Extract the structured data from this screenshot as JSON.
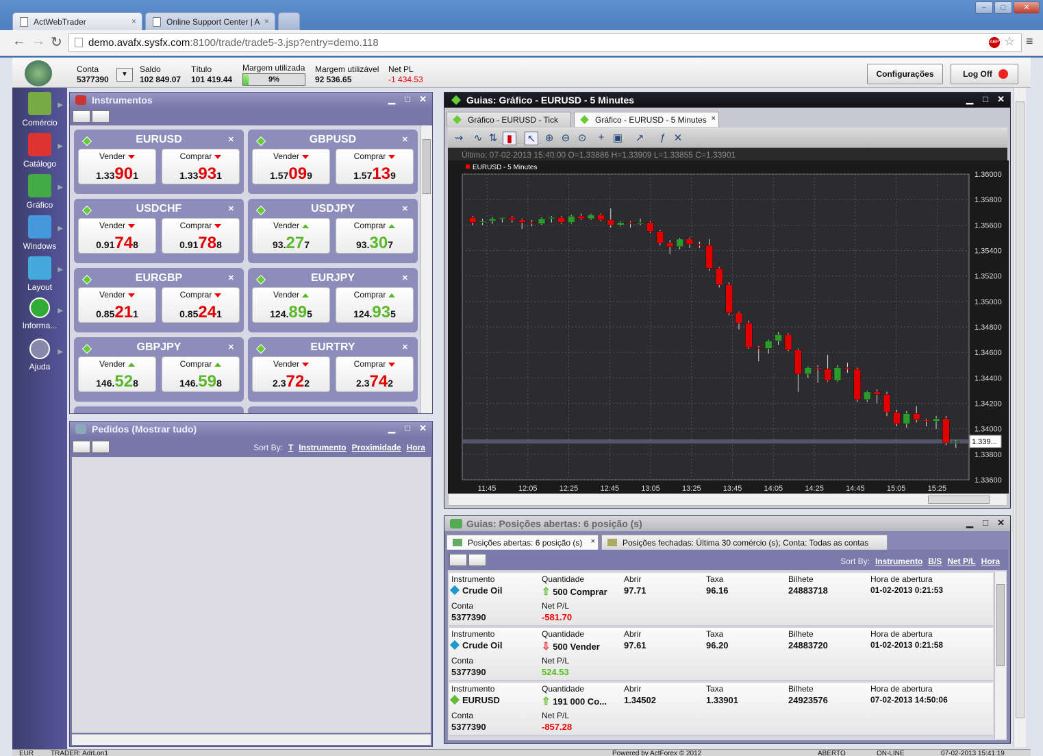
{
  "browser": {
    "tabs": [
      "ActWebTrader",
      "Online Support Center | A"
    ],
    "url_host": "demo.avafx.sysfx.com",
    "url_rest": ":8100/trade/trade5-3.jsp?entry=demo.118"
  },
  "header": {
    "conta_label": "Conta",
    "conta_value": "5377390",
    "saldo_label": "Saldo",
    "saldo_value": "102 849.07",
    "titulo_label": "Título",
    "titulo_value": "101 419.44",
    "margem_util_label": "Margem utilizada",
    "margem_util_value": "9%",
    "margem_util_fraction": 0.09,
    "margem_disp_label": "Margem utilizável",
    "margem_disp_value": "92 536.65",
    "netpl_label": "Net PL",
    "netpl_value": "-1 434.53",
    "config_button": "Configurações",
    "logoff_button": "Log Off"
  },
  "sidebar": [
    {
      "label": "Comércio",
      "icon": "money-icon"
    },
    {
      "label": "Catálogo",
      "icon": "currency-icon"
    },
    {
      "label": "Gráfico",
      "icon": "chart-icon"
    },
    {
      "label": "Windows",
      "icon": "windows-icon"
    },
    {
      "label": "Layout",
      "icon": "layout-icon"
    },
    {
      "label": "Informa...",
      "icon": "info-icon"
    },
    {
      "label": "Ajuda",
      "icon": "help-icon"
    }
  ],
  "instruments_panel": {
    "title": "Instrumentos",
    "sell_label": "Vender",
    "buy_label": "Comprar",
    "cards": [
      {
        "name": "EURUSD",
        "dir_sell": "down",
        "dir_buy": "down",
        "sell": [
          "1.33",
          "90",
          "1"
        ],
        "buy": [
          "1.33",
          "93",
          "1"
        ]
      },
      {
        "name": "GBPUSD",
        "dir_sell": "down",
        "dir_buy": "down",
        "sell": [
          "1.57",
          "09",
          "9"
        ],
        "buy": [
          "1.57",
          "13",
          "9"
        ]
      },
      {
        "name": "USDCHF",
        "dir_sell": "down",
        "dir_buy": "down",
        "sell": [
          "0.91",
          "74",
          "8"
        ],
        "buy": [
          "0.91",
          "78",
          "8"
        ]
      },
      {
        "name": "USDJPY",
        "dir_sell": "up",
        "dir_buy": "up",
        "sell": [
          "93.",
          "27",
          "7"
        ],
        "buy": [
          "93.",
          "30",
          "7"
        ]
      },
      {
        "name": "EURGBP",
        "dir_sell": "down",
        "dir_buy": "down",
        "sell": [
          "0.85",
          "21",
          "1"
        ],
        "buy": [
          "0.85",
          "24",
          "1"
        ]
      },
      {
        "name": "EURJPY",
        "dir_sell": "up",
        "dir_buy": "up",
        "sell": [
          "124.",
          "89",
          "5"
        ],
        "buy": [
          "124.",
          "93",
          "5"
        ]
      },
      {
        "name": "GBPJPY",
        "dir_sell": "up",
        "dir_buy": "up",
        "sell": [
          "146.",
          "52",
          "8"
        ],
        "buy": [
          "146.",
          "59",
          "8"
        ]
      },
      {
        "name": "EURTRY",
        "dir_sell": "down",
        "dir_buy": "down",
        "sell": [
          "2.3",
          "72",
          "2"
        ],
        "buy": [
          "2.3",
          "74",
          "2"
        ]
      }
    ]
  },
  "orders_panel": {
    "title": "Pedidos (Mostrar tudo)",
    "sort_label": "Sort By:",
    "sort_links": [
      "T",
      "Instrumento",
      "Proximidade",
      "Hora"
    ]
  },
  "chart_panel": {
    "title": "Guias: Gráfico - EURUSD - 5 Minutes",
    "tabs": [
      "Gráfico - EURUSD - Tick",
      "Gráfico - EURUSD - 5 Minutes"
    ],
    "info_line": "Último: 07-02-2013 15:40:00 O=1.33886 H=1.33909 L=1.33855 C=1.33901",
    "current_price_label": "1.339..."
  },
  "chart_data": {
    "type": "candlestick",
    "series_name": "EURUSD - 5 Minutes",
    "x_ticks": [
      "11:45",
      "12:05",
      "12:25",
      "12:45",
      "13:05",
      "13:25",
      "13:45",
      "14:05",
      "14:25",
      "14:45",
      "15:05",
      "15:25"
    ],
    "y_ticks": [
      "1.36000",
      "1.35800",
      "1.35600",
      "1.35400",
      "1.35200",
      "1.35000",
      "1.34800",
      "1.34600",
      "1.34400",
      "1.34200",
      "1.34000",
      "1.33800",
      "1.33600"
    ],
    "ylim": [
      1.336,
      1.36
    ],
    "current_price": 1.33901,
    "grid": true,
    "up_color": "#2a9a2a",
    "down_color": "#e00000",
    "candles": [
      [
        1.3566,
        1.3567,
        1.356,
        1.3562
      ],
      [
        1.3562,
        1.3565,
        1.356,
        1.3563
      ],
      [
        1.3563,
        1.3566,
        1.3561,
        1.3565
      ],
      [
        1.3565,
        1.3566,
        1.3562,
        1.3566
      ],
      [
        1.3566,
        1.3567,
        1.3562,
        1.3564
      ],
      [
        1.3564,
        1.3565,
        1.3557,
        1.3562
      ],
      [
        1.3562,
        1.3564,
        1.3559,
        1.3561
      ],
      [
        1.3561,
        1.3566,
        1.356,
        1.3565
      ],
      [
        1.3565,
        1.3567,
        1.3562,
        1.3566
      ],
      [
        1.3566,
        1.3567,
        1.3561,
        1.3562
      ],
      [
        1.3562,
        1.3568,
        1.3561,
        1.3567
      ],
      [
        1.3567,
        1.3569,
        1.3564,
        1.3565
      ],
      [
        1.3565,
        1.3569,
        1.3564,
        1.3568
      ],
      [
        1.3568,
        1.3569,
        1.3563,
        1.3564
      ],
      [
        1.3564,
        1.3573,
        1.3558,
        1.356
      ],
      [
        1.356,
        1.3563,
        1.3559,
        1.3562
      ],
      [
        1.3562,
        1.3563,
        1.3558,
        1.3561
      ],
      [
        1.3561,
        1.3565,
        1.356,
        1.3562
      ],
      [
        1.3562,
        1.3563,
        1.3554,
        1.3555
      ],
      [
        1.3555,
        1.3556,
        1.3544,
        1.3546
      ],
      [
        1.3546,
        1.3548,
        1.3537,
        1.3543
      ],
      [
        1.3543,
        1.355,
        1.3541,
        1.3549
      ],
      [
        1.3549,
        1.355,
        1.3542,
        1.3545
      ],
      [
        1.3545,
        1.3547,
        1.3542,
        1.3544
      ],
      [
        1.3544,
        1.3549,
        1.3524,
        1.3526
      ],
      [
        1.3526,
        1.3527,
        1.3511,
        1.3513
      ],
      [
        1.3513,
        1.3515,
        1.3489,
        1.3491
      ],
      [
        1.3491,
        1.3492,
        1.3478,
        1.3483
      ],
      [
        1.3483,
        1.3485,
        1.3463,
        1.3464
      ],
      [
        1.3464,
        1.3465,
        1.3453,
        1.3463
      ],
      [
        1.3463,
        1.347,
        1.3459,
        1.3469
      ],
      [
        1.3469,
        1.3476,
        1.3466,
        1.3474
      ],
      [
        1.3474,
        1.3475,
        1.3461,
        1.3462
      ],
      [
        1.3462,
        1.3463,
        1.3429,
        1.3443
      ],
      [
        1.3443,
        1.3449,
        1.344,
        1.3448
      ],
      [
        1.3448,
        1.345,
        1.3436,
        1.3447
      ],
      [
        1.3447,
        1.3458,
        1.3437,
        1.3438
      ],
      [
        1.3438,
        1.345,
        1.3437,
        1.3448
      ],
      [
        1.3448,
        1.3452,
        1.3444,
        1.3447
      ],
      [
        1.3447,
        1.3448,
        1.3421,
        1.3423
      ],
      [
        1.3423,
        1.343,
        1.3421,
        1.3429
      ],
      [
        1.3429,
        1.3431,
        1.342,
        1.3427
      ],
      [
        1.3427,
        1.3429,
        1.341,
        1.3413
      ],
      [
        1.3413,
        1.3415,
        1.3402,
        1.3404
      ],
      [
        1.3404,
        1.3414,
        1.3401,
        1.3412
      ],
      [
        1.3412,
        1.3418,
        1.3405,
        1.3407
      ],
      [
        1.3407,
        1.3408,
        1.3402,
        1.3406
      ],
      [
        1.3406,
        1.341,
        1.34,
        1.3408
      ],
      [
        1.3408,
        1.341,
        1.3387,
        1.3389
      ],
      [
        1.3389,
        1.3391,
        1.3385,
        1.339
      ]
    ]
  },
  "positions_panel": {
    "title": "Guias: Posições abertas: 6 posição (s)",
    "tabs": [
      "Posições abertas: 6 posição (s)",
      "Posições fechadas: Última 30 comércio (s); Conta: Todas as contas"
    ],
    "sort_label": "Sort By:",
    "sort_links": [
      "Instrumento",
      "B/S",
      "Net P/L",
      "Hora"
    ],
    "col_labels": {
      "instrumento": "Instrumento",
      "quantidade": "Quantidade",
      "abrir": "Abrir",
      "taxa": "Taxa",
      "bilhete": "Bilhete",
      "hora": "Hora de abertura",
      "conta": "Conta",
      "netpl": "Net P/L"
    },
    "rows": [
      {
        "instrument": "Crude Oil",
        "icon": "oil-diamond-icon",
        "dir": "up",
        "qty": "500 Comprar",
        "abrir": "97.71",
        "taxa": "96.16",
        "bilhete": "24883718",
        "hora": "01-02-2013 0:21:53",
        "conta": "5377390",
        "netpl": "-581.70",
        "pl_sign": "neg"
      },
      {
        "instrument": "Crude Oil",
        "icon": "oil-diamond-icon",
        "dir": "down",
        "qty": "500 Vender",
        "abrir": "97.61",
        "taxa": "96.20",
        "bilhete": "24883720",
        "hora": "01-02-2013 0:21:58",
        "conta": "5377390",
        "netpl": "524.53",
        "pl_sign": "pos"
      },
      {
        "instrument": "EURUSD",
        "icon": "fx-diamond-icon",
        "dir": "up",
        "qty": "191 000 Co...",
        "abrir": "1.34502",
        "taxa": "1.33901",
        "bilhete": "24923576",
        "hora": "07-02-2013 14:50:06",
        "conta": "5377390",
        "netpl": "-857.28",
        "pl_sign": "neg"
      }
    ]
  },
  "statusbar": {
    "currency": "EUR",
    "trader": "TRADER: AdrLon1",
    "powered": "Powered by ActForex © 2012",
    "state": "ABERTO",
    "online": "ON-LINE",
    "time": "07-02-2013 15:41:19"
  }
}
